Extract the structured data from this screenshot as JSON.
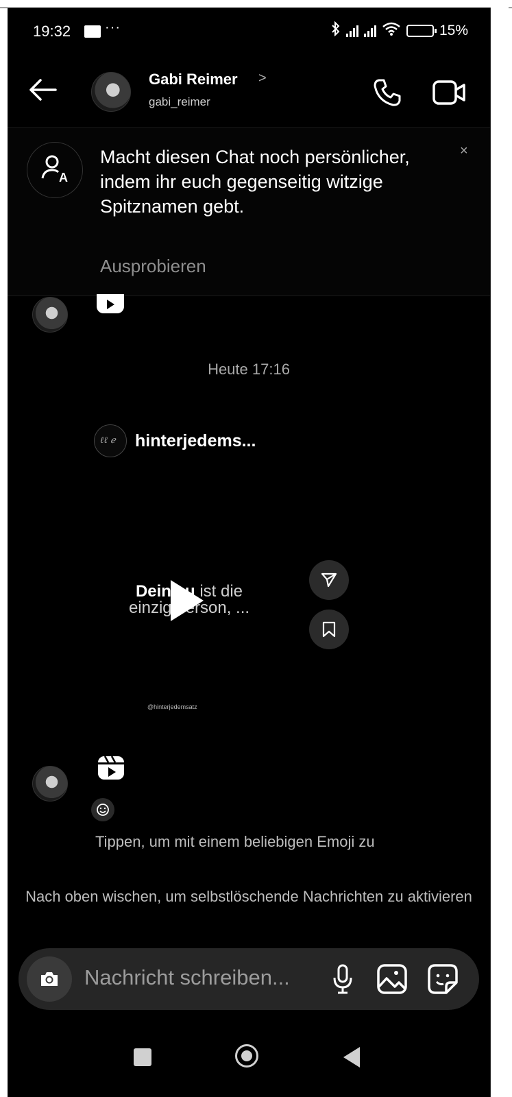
{
  "status_bar": {
    "time": "19:32",
    "dots": "···",
    "battery": "15%"
  },
  "header": {
    "name": "Gabi Reimer",
    "chevron": ">",
    "username": "gabi_reimer"
  },
  "banner": {
    "text": "Macht diesen Chat noch persönlicher, indem ihr euch gegenseitig witzige Spitznamen gebt.",
    "action": "Ausprobieren",
    "close": "×"
  },
  "timeline": {
    "date_separator": "Heute 17:16"
  },
  "shared_post": {
    "account": "hinterjedems...",
    "avatar_text": "ℓℓ ℯ",
    "overlay_bold": "Deine ",
    "overlay_bold2": "u",
    "overlay_rest1": " ist die",
    "overlay_line2": "einzige  erson, ...",
    "handle": "@hinterjedemsatz"
  },
  "hints": {
    "emoji": "Tippen, um mit einem beliebigen Emoji zu",
    "swipe": "Nach oben wischen, um selbstlöschende Nachrichten zu aktivieren"
  },
  "composer": {
    "placeholder": "Nachricht schreiben..."
  },
  "colors": {
    "background": "#000000",
    "secondary_text": "#8e8e8e",
    "composer_bg": "#262626"
  },
  "icons": [
    "back-arrow-icon",
    "phone-icon",
    "video-camera-icon",
    "nickname-icon",
    "youtube-icon",
    "send-icon",
    "bookmark-icon",
    "reel-icon",
    "add-reaction-icon",
    "camera-icon",
    "microphone-icon",
    "gallery-icon",
    "sticker-icon"
  ]
}
